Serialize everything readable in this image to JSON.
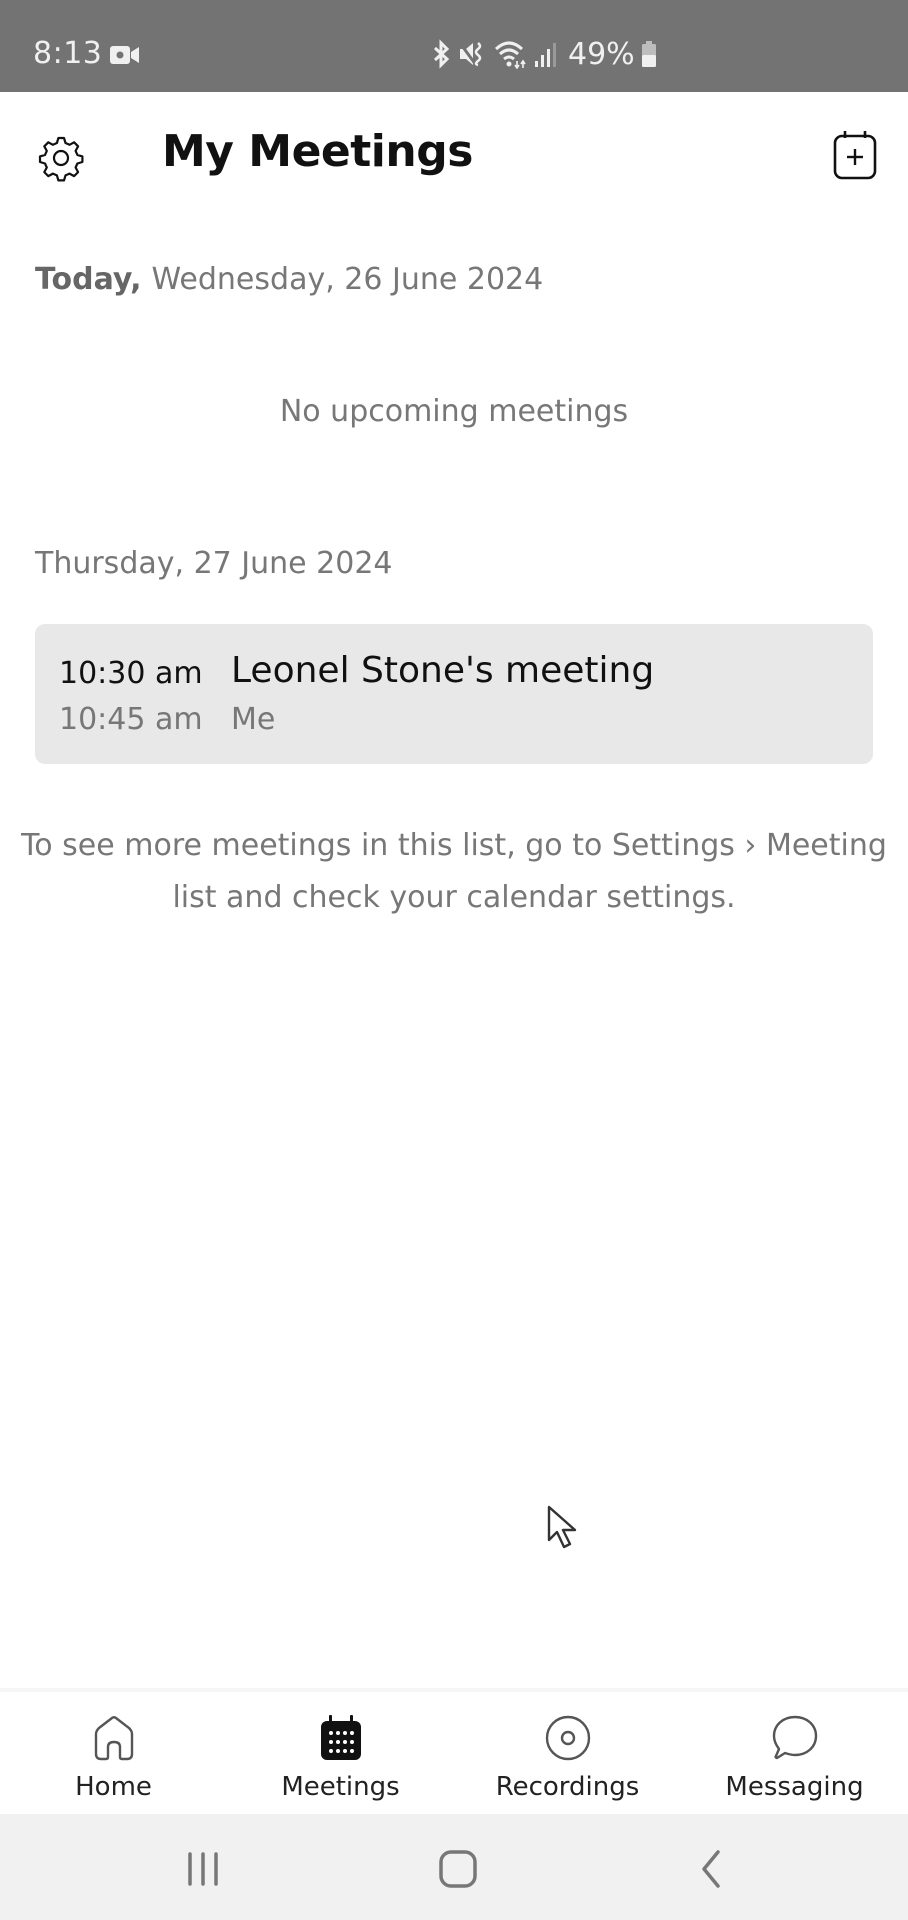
{
  "status_bar": {
    "time": "8:13",
    "battery_percent": "49%",
    "icons": [
      "video-camera-icon",
      "bluetooth-icon",
      "mute-vibrate-icon",
      "wifi-icon",
      "signal-icon",
      "battery-icon"
    ]
  },
  "header": {
    "title": "My Meetings",
    "settings_icon": "gear-icon",
    "add_icon": "calendar-add-icon"
  },
  "today": {
    "label": "Today,",
    "date": "Wednesday, 26 June 2024",
    "empty_message": "No upcoming meetings"
  },
  "days": [
    {
      "heading": "Thursday, 27 June 2024",
      "meetings": [
        {
          "start": "10:30 am",
          "end": "10:45 am",
          "title": "Leonel Stone's meeting",
          "organizer": "Me"
        }
      ]
    }
  ],
  "hint": "To see more meetings in this list, go to Settings › Meeting list and check your calendar settings.",
  "bottom_nav": {
    "active": "Meetings",
    "items": [
      {
        "label": "Home",
        "icon": "home-icon"
      },
      {
        "label": "Meetings",
        "icon": "calendar-icon"
      },
      {
        "label": "Recordings",
        "icon": "recording-icon"
      },
      {
        "label": "Messaging",
        "icon": "chat-bubble-icon"
      }
    ]
  },
  "system_nav": {
    "items": [
      "recent-apps-icon",
      "home-button-icon",
      "back-icon"
    ]
  },
  "colors": {
    "status_bar_bg": "#737373",
    "card_bg": "#e8e8e8",
    "muted_text": "#777777",
    "primary_text": "#111111",
    "system_nav_bg": "#f1f1f1"
  }
}
